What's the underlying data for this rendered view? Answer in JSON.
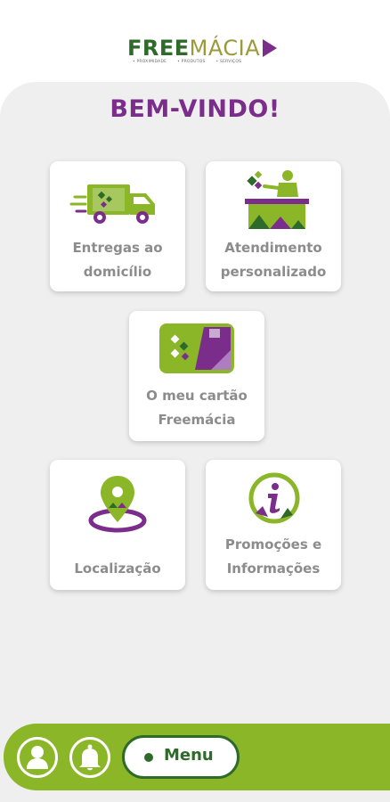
{
  "header": {
    "logo_part1": "FREE",
    "logo_part2": "MÁCIA",
    "logo_tags": [
      "• PROXIMIDADE",
      "• PRODUTOS",
      "• SERVIÇOS"
    ]
  },
  "main": {
    "welcome": "BEM-VINDO!",
    "cards": [
      {
        "line1": "Entregas ao",
        "line2": "domicílio",
        "icon": "delivery-truck-icon"
      },
      {
        "line1": "Atendimento",
        "line2": "personalizado",
        "icon": "pharmacist-counter-icon"
      },
      {
        "line1": "O meu cartão",
        "line2": "Freemácia",
        "icon": "loyalty-card-icon"
      },
      {
        "line1": "Localização",
        "line2": "",
        "icon": "location-pin-icon"
      },
      {
        "line1": "Promoções e",
        "line2": "Informações",
        "icon": "info-icon"
      }
    ]
  },
  "bottom_bar": {
    "menu_label": "Menu",
    "profile_icon": "user-icon",
    "notifications_icon": "bell-icon"
  },
  "colors": {
    "purple": "#7b2d8b",
    "green": "#8ab628",
    "dark_green": "#2e6b2a",
    "label_gray": "#8c8c8c",
    "background": "#efefef"
  }
}
